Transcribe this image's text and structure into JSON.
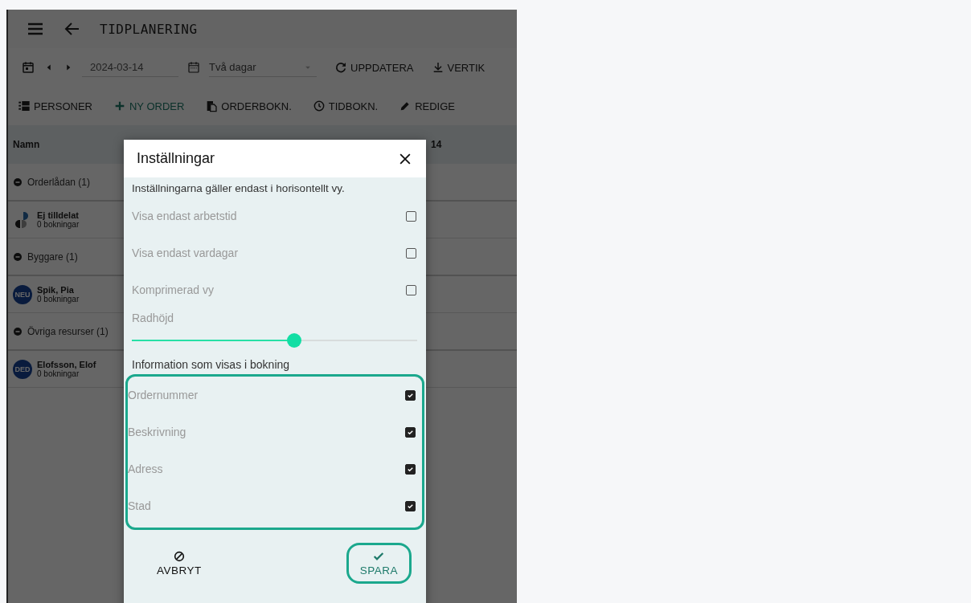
{
  "app_bar": {
    "title": "TIDPLANERING"
  },
  "toolbar": {
    "date": "2024-03-14",
    "view_select": "Två dagar",
    "buttons": [
      {
        "label": "UPPDATERA",
        "kind": "refresh"
      },
      {
        "label": "VERTIK",
        "kind": "download"
      }
    ]
  },
  "actions": [
    {
      "label": "PERSONER",
      "kind": "list"
    },
    {
      "label": "NY ORDER",
      "kind": "add"
    },
    {
      "label": "ORDERBOKN.",
      "kind": "paste"
    },
    {
      "label": "TIDBOKN.",
      "kind": "clock"
    },
    {
      "label": "REDIGE",
      "kind": "edit"
    }
  ],
  "table": {
    "columns": [
      "Namn",
      "14"
    ],
    "rows": [
      {
        "kind": "group",
        "name": "Orderlådan (1)"
      },
      {
        "kind": "unassigned",
        "name": "Ej tilldelat",
        "sub": "0 bokningar"
      },
      {
        "kind": "group",
        "name": "Byggare (1)"
      },
      {
        "kind": "person",
        "name": "Spik, Pia",
        "sub": "0 bokningar",
        "initials": "NEU"
      },
      {
        "kind": "group",
        "name": "Övriga resurser (1)"
      },
      {
        "kind": "person",
        "name": "Elofsson, Elof",
        "sub": "0 bokningar",
        "initials": "DED"
      }
    ]
  },
  "dialog": {
    "title": "Inställningar",
    "note": "Inställningarna gäller endast i horisontellt vy.",
    "options": [
      {
        "label": "Visa endast arbetstid",
        "checked": false
      },
      {
        "label": "Visa endast vardagar",
        "checked": false
      },
      {
        "label": "Komprimerad vy",
        "checked": false
      }
    ],
    "slider": {
      "label": "Radhöjd",
      "level": 0.57
    },
    "section": "Information som visas i bokning",
    "fields_highlighted": true,
    "fields": [
      {
        "label": "Ordernummer",
        "checked": true
      },
      {
        "label": "Beskrivning",
        "checked": true
      },
      {
        "label": "Adress",
        "checked": true
      },
      {
        "label": "Stad",
        "checked": true
      }
    ],
    "buttons": [
      {
        "label": "AVBRYT",
        "kind": "cancel",
        "highlighted": false
      },
      {
        "label": "SPARA",
        "kind": "save",
        "highlighted": true
      }
    ]
  }
}
